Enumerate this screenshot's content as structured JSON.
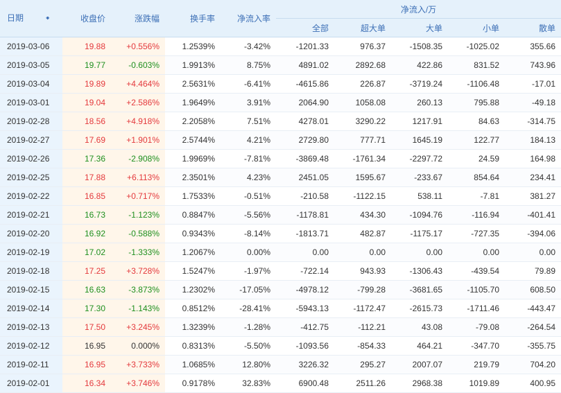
{
  "header": {
    "date": "日期",
    "close": "收盘价",
    "change": "涨跌幅",
    "turnover": "换手率",
    "netflow_rate": "净流入率",
    "netflow_group": "净流入/万",
    "all": "全部",
    "super_large": "超大单",
    "large": "大单",
    "small": "小单",
    "retail": "散单"
  },
  "icons": {
    "sort": "sort-down-arrow-icon"
  },
  "colors": {
    "up": "#e4393c",
    "down": "#1e8f1e",
    "header_bg": "#e5f1fb",
    "header_text": "#3c6fb6"
  },
  "rows": [
    {
      "date": "2019-03-06",
      "close": "19.88",
      "change": "+0.556%",
      "dir": "up",
      "turnover": "1.2539%",
      "rate": "-3.42%",
      "all": "-1201.33",
      "super": "976.37",
      "large": "-1508.35",
      "small": "-1025.02",
      "retail": "355.66"
    },
    {
      "date": "2019-03-05",
      "close": "19.77",
      "change": "-0.603%",
      "dir": "down",
      "turnover": "1.9913%",
      "rate": "8.75%",
      "all": "4891.02",
      "super": "2892.68",
      "large": "422.86",
      "small": "831.52",
      "retail": "743.96"
    },
    {
      "date": "2019-03-04",
      "close": "19.89",
      "change": "+4.464%",
      "dir": "up",
      "turnover": "2.5631%",
      "rate": "-6.41%",
      "all": "-4615.86",
      "super": "226.87",
      "large": "-3719.24",
      "small": "-1106.48",
      "retail": "-17.01"
    },
    {
      "date": "2019-03-01",
      "close": "19.04",
      "change": "+2.586%",
      "dir": "up",
      "turnover": "1.9649%",
      "rate": "3.91%",
      "all": "2064.90",
      "super": "1058.08",
      "large": "260.13",
      "small": "795.88",
      "retail": "-49.18"
    },
    {
      "date": "2019-02-28",
      "close": "18.56",
      "change": "+4.918%",
      "dir": "up",
      "turnover": "2.2058%",
      "rate": "7.51%",
      "all": "4278.01",
      "super": "3290.22",
      "large": "1217.91",
      "small": "84.63",
      "retail": "-314.75"
    },
    {
      "date": "2019-02-27",
      "close": "17.69",
      "change": "+1.901%",
      "dir": "up",
      "turnover": "2.5744%",
      "rate": "4.21%",
      "all": "2729.80",
      "super": "777.71",
      "large": "1645.19",
      "small": "122.77",
      "retail": "184.13"
    },
    {
      "date": "2019-02-26",
      "close": "17.36",
      "change": "-2.908%",
      "dir": "down",
      "turnover": "1.9969%",
      "rate": "-7.81%",
      "all": "-3869.48",
      "super": "-1761.34",
      "large": "-2297.72",
      "small": "24.59",
      "retail": "164.98"
    },
    {
      "date": "2019-02-25",
      "close": "17.88",
      "change": "+6.113%",
      "dir": "up",
      "turnover": "2.3501%",
      "rate": "4.23%",
      "all": "2451.05",
      "super": "1595.67",
      "large": "-233.67",
      "small": "854.64",
      "retail": "234.41"
    },
    {
      "date": "2019-02-22",
      "close": "16.85",
      "change": "+0.717%",
      "dir": "up",
      "turnover": "1.7533%",
      "rate": "-0.51%",
      "all": "-210.58",
      "super": "-1122.15",
      "large": "538.11",
      "small": "-7.81",
      "retail": "381.27"
    },
    {
      "date": "2019-02-21",
      "close": "16.73",
      "change": "-1.123%",
      "dir": "down",
      "turnover": "0.8847%",
      "rate": "-5.56%",
      "all": "-1178.81",
      "super": "434.30",
      "large": "-1094.76",
      "small": "-116.94",
      "retail": "-401.41"
    },
    {
      "date": "2019-02-20",
      "close": "16.92",
      "change": "-0.588%",
      "dir": "down",
      "turnover": "0.9343%",
      "rate": "-8.14%",
      "all": "-1813.71",
      "super": "482.87",
      "large": "-1175.17",
      "small": "-727.35",
      "retail": "-394.06"
    },
    {
      "date": "2019-02-19",
      "close": "17.02",
      "change": "-1.333%",
      "dir": "down",
      "turnover": "1.2067%",
      "rate": "0.00%",
      "all": "0.00",
      "super": "0.00",
      "large": "0.00",
      "small": "0.00",
      "retail": "0.00"
    },
    {
      "date": "2019-02-18",
      "close": "17.25",
      "change": "+3.728%",
      "dir": "up",
      "turnover": "1.5247%",
      "rate": "-1.97%",
      "all": "-722.14",
      "super": "943.93",
      "large": "-1306.43",
      "small": "-439.54",
      "retail": "79.89"
    },
    {
      "date": "2019-02-15",
      "close": "16.63",
      "change": "-3.873%",
      "dir": "down",
      "turnover": "1.2302%",
      "rate": "-17.05%",
      "all": "-4978.12",
      "super": "-799.28",
      "large": "-3681.65",
      "small": "-1105.70",
      "retail": "608.50"
    },
    {
      "date": "2019-02-14",
      "close": "17.30",
      "change": "-1.143%",
      "dir": "down",
      "turnover": "0.8512%",
      "rate": "-28.41%",
      "all": "-5943.13",
      "super": "-1172.47",
      "large": "-2615.73",
      "small": "-1711.46",
      "retail": "-443.47"
    },
    {
      "date": "2019-02-13",
      "close": "17.50",
      "change": "+3.245%",
      "dir": "up",
      "turnover": "1.3239%",
      "rate": "-1.28%",
      "all": "-412.75",
      "super": "-112.21",
      "large": "43.08",
      "small": "-79.08",
      "retail": "-264.54"
    },
    {
      "date": "2019-02-12",
      "close": "16.95",
      "change": "0.000%",
      "dir": "flat",
      "turnover": "0.8313%",
      "rate": "-5.50%",
      "all": "-1093.56",
      "super": "-854.33",
      "large": "464.21",
      "small": "-347.70",
      "retail": "-355.75"
    },
    {
      "date": "2019-02-11",
      "close": "16.95",
      "change": "+3.733%",
      "dir": "up",
      "turnover": "1.0685%",
      "rate": "12.80%",
      "all": "3226.32",
      "super": "295.27",
      "large": "2007.07",
      "small": "219.79",
      "retail": "704.20"
    },
    {
      "date": "2019-02-01",
      "close": "16.34",
      "change": "+3.746%",
      "dir": "up",
      "turnover": "0.9178%",
      "rate": "32.83%",
      "all": "6900.48",
      "super": "2511.26",
      "large": "2968.38",
      "small": "1019.89",
      "retail": "400.95"
    }
  ]
}
